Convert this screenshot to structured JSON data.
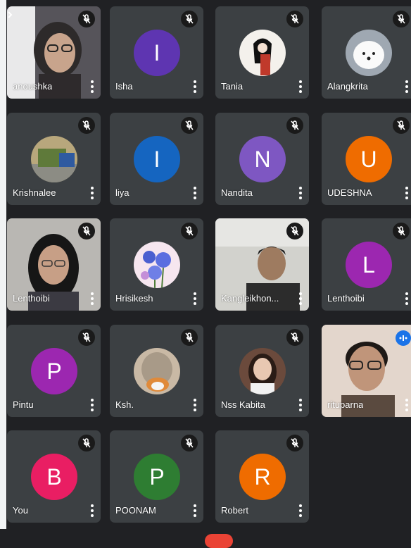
{
  "participants": [
    {
      "name": "anoushka",
      "kind": "video"
    },
    {
      "name": "Isha",
      "kind": "letter",
      "letter": "I",
      "color": "#5e35b1"
    },
    {
      "name": "Tania",
      "kind": "photo",
      "photo": "sketch-portrait"
    },
    {
      "name": "Alangkrita",
      "kind": "photo",
      "photo": "white-puppy"
    },
    {
      "name": "Krishnalee",
      "kind": "photo",
      "photo": "street-scene"
    },
    {
      "name": "liya",
      "kind": "letter",
      "letter": "I",
      "color": "#1565c0"
    },
    {
      "name": "Nandita",
      "kind": "letter",
      "letter": "N",
      "color": "#7e57c2"
    },
    {
      "name": "UDESHNA",
      "kind": "letter",
      "letter": "U",
      "color": "#ef6c00"
    },
    {
      "name": "Lenthoibi",
      "kind": "video"
    },
    {
      "name": "Hrisikesh",
      "kind": "photo",
      "photo": "blue-flowers"
    },
    {
      "name": "Kangleikhon...",
      "kind": "video"
    },
    {
      "name": "Lenthoibi",
      "kind": "letter",
      "letter": "L",
      "color": "#9c27b0"
    },
    {
      "name": "Pintu",
      "kind": "letter",
      "letter": "P",
      "color": "#9c27b0"
    },
    {
      "name": "Ksh.",
      "kind": "photo",
      "photo": "cat"
    },
    {
      "name": "Nss Kabita",
      "kind": "photo",
      "photo": "girl-portrait"
    },
    {
      "name": "rituparna",
      "kind": "video",
      "speaking": true
    },
    {
      "name": "You",
      "kind": "letter",
      "letter": "B",
      "color": "#e91e63"
    },
    {
      "name": "POONAM",
      "kind": "letter",
      "letter": "P",
      "color": "#2e7d32"
    },
    {
      "name": "Robert",
      "kind": "letter",
      "letter": "R",
      "color": "#ef6c00"
    }
  ],
  "icons": {
    "mute": "mic-off-icon",
    "menu": "more-vert-icon",
    "speaking": "audio-level-icon"
  },
  "colors": {
    "background": "#202124",
    "tile": "#3c4043",
    "end_call": "#ea4335",
    "speaking_badge": "#1a73e8"
  }
}
